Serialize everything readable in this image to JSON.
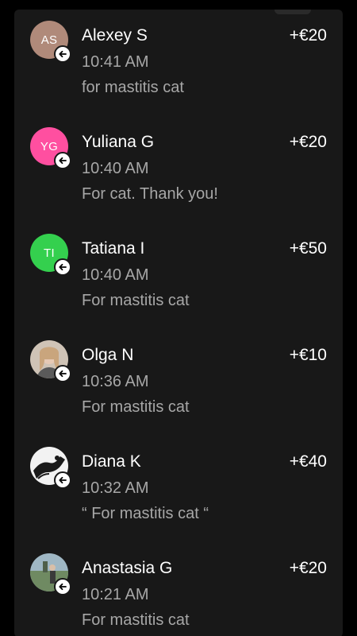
{
  "transactions": [
    {
      "name": "Alexey S",
      "time": "10:41 AM",
      "note": "for mastitis cat",
      "amount": "+€20",
      "initials": "AS",
      "avatar_color": "#b08a7a"
    },
    {
      "name": "Yuliana G",
      "time": "10:40 AM",
      "note": "For cat. Thank you!",
      "amount": "+€20",
      "initials": "YG",
      "avatar_color": "#ff4fa0"
    },
    {
      "name": "Tatiana I",
      "time": "10:40 AM",
      "note": "For mastitis cat",
      "amount": "+€50",
      "initials": "TI",
      "avatar_color": "#34d04e"
    },
    {
      "name": "Olga N",
      "time": "10:36 AM",
      "note": "For mastitis cat",
      "amount": "+€10",
      "avatar_type": "photo"
    },
    {
      "name": "Diana K",
      "time": "10:32 AM",
      "note": "“ For mastitis cat “",
      "amount": "+€40",
      "avatar_type": "photo"
    },
    {
      "name": "Anastasia G",
      "time": "10:21 AM",
      "note": "For mastitis cat",
      "amount": "+€20",
      "avatar_type": "photo"
    }
  ],
  "colors": {
    "background": "#000000",
    "panel": "#181818",
    "text_primary": "#ffffff",
    "text_secondary": "#a7a7a7"
  },
  "icons": {
    "incoming_badge": "arrow-left-icon"
  }
}
